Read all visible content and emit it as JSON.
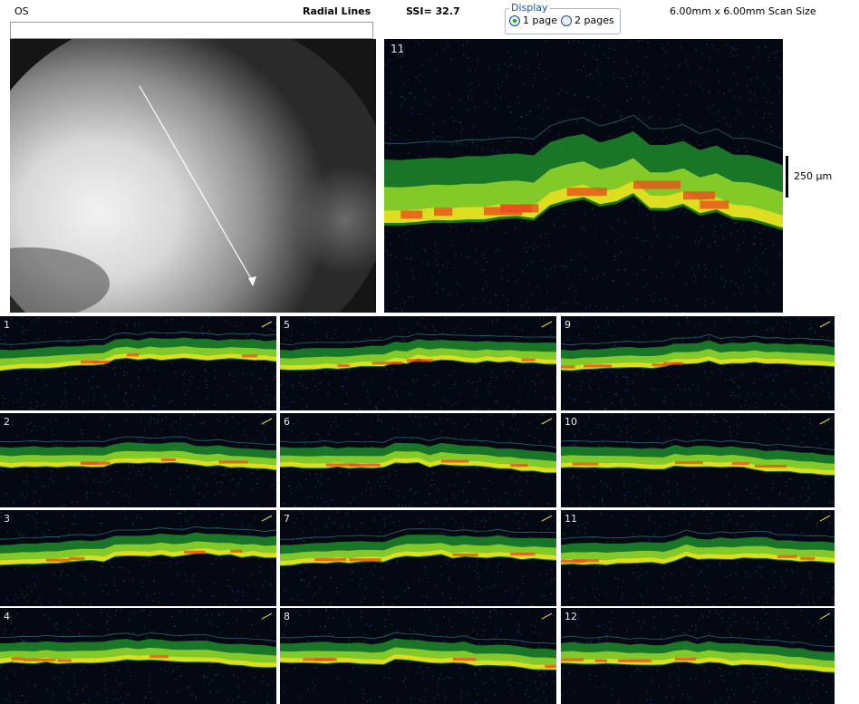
{
  "header": {
    "eye": "OS",
    "protocol": "Radial Lines",
    "ssi": "SSI= 32.7",
    "scan_size": "6.00mm x 6.00mm Scan Size"
  },
  "display": {
    "legend": "Display",
    "options": [
      {
        "label": "1 page",
        "selected": true
      },
      {
        "label": "2 pages",
        "selected": false
      }
    ]
  },
  "main_scan": {
    "number": "11",
    "scale_label": "250 µm"
  },
  "thumbnails": [
    {
      "number": "1"
    },
    {
      "number": "2"
    },
    {
      "number": "3"
    },
    {
      "number": "4"
    },
    {
      "number": "5"
    },
    {
      "number": "6"
    },
    {
      "number": "7"
    },
    {
      "number": "8"
    },
    {
      "number": "9"
    },
    {
      "number": "10"
    },
    {
      "number": "11"
    },
    {
      "number": "12"
    }
  ],
  "colors": {
    "scan_background": "#040812",
    "retina_outer": "#1f8a2c",
    "retina_mid": "#8fd42a",
    "retina_bright": "#e8e020",
    "retina_hot": "#e8501c",
    "arrow": "#e8d840"
  }
}
